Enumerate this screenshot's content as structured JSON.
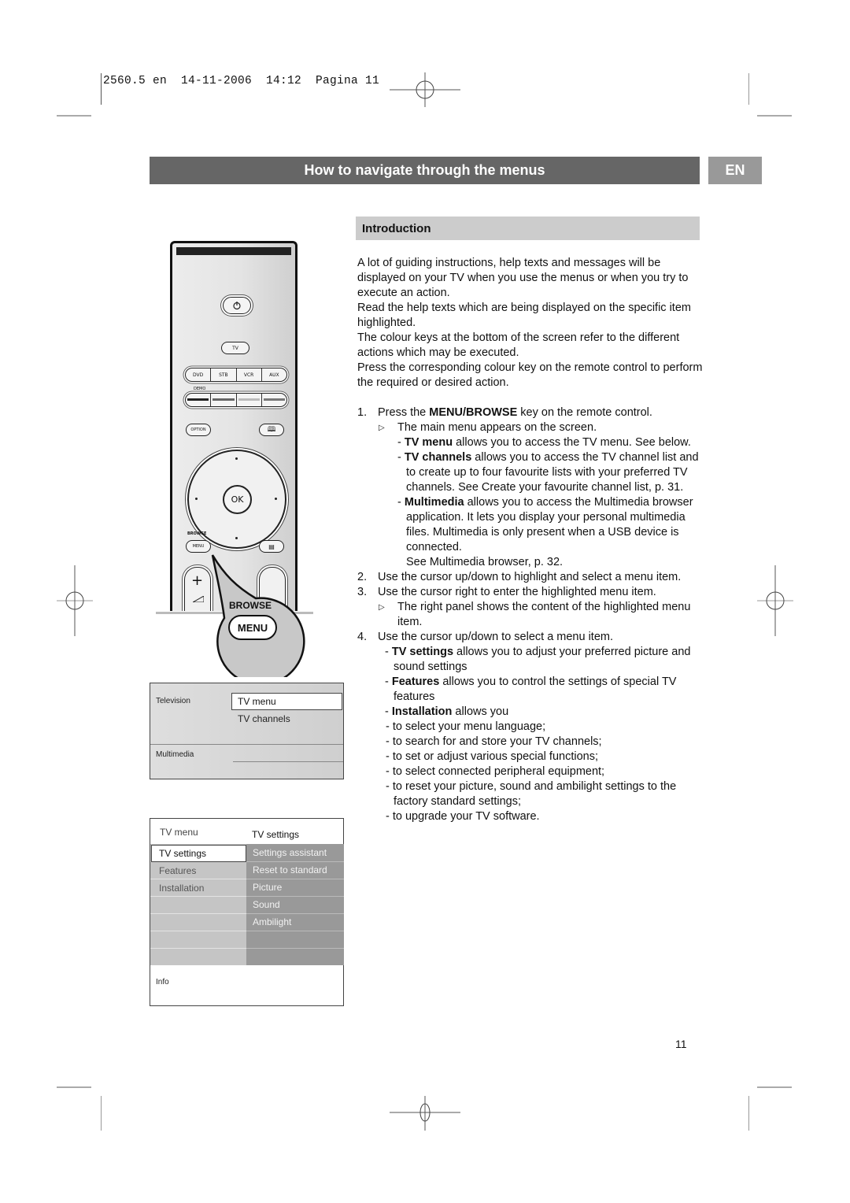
{
  "slug": {
    "text": "2560.5 en  14-11-2006  14:12  Pagina 11"
  },
  "header": {
    "title": "How to navigate through the menus",
    "language_tab": "EN"
  },
  "section": {
    "title": "Introduction"
  },
  "intro": [
    "A lot of guiding instructions, help texts and messages will be displayed on your TV when you use the menus or when you try to execute an action.",
    "Read the help texts which are being displayed on the specific item highlighted.",
    "The colour keys at the bottom of the screen refer to the different actions which may be executed.",
    "Press the corresponding colour key on the remote control to perform the required or desired action."
  ],
  "steps": {
    "s1": {
      "num": "1.",
      "pre": "Press the ",
      "bold": "MENU/BROWSE",
      "post": " key on the remote control."
    },
    "s1_result": "The main menu appears on the screen.",
    "s1_items": [
      {
        "bold": "TV menu",
        "text": " allows you to access the TV menu. See below."
      },
      {
        "bold": "TV channels",
        "text": " allows you to access the TV channel list and to create up to four favourite lists with your preferred TV channels. See Create your favourite channel list, p. 31."
      },
      {
        "bold": "Multimedia",
        "text": " allows you to access the Multimedia browser application. It lets you display your personal multimedia files. Multimedia is only present when a USB device is connected."
      }
    ],
    "s1_see": "See Multimedia browser, p. 32.",
    "s2": {
      "num": "2.",
      "text": "Use the cursor up/down to highlight and select a menu item."
    },
    "s3": {
      "num": "3.",
      "text": "Use the cursor right to enter the highlighted menu item."
    },
    "s3_result": "The right panel shows the content of the highlighted menu item.",
    "s4": {
      "num": "4.",
      "text": "Use the cursor up/down to select a menu item."
    },
    "s4_items": [
      {
        "bold": "TV settings",
        "text": " allows you to adjust your preferred picture and sound settings"
      },
      {
        "bold": "Features",
        "text": " allows you to control the settings of special TV features"
      },
      {
        "bold": "Installation",
        "text": " allows you"
      }
    ],
    "installation_items": [
      "to select your menu language;",
      "to search for and store your TV channels;",
      "to set or adjust various special functions;",
      "to select connected peripheral equipment;",
      "to reset your picture, sound and ambilight settings to the factory standard settings;",
      "to upgrade your TV software."
    ]
  },
  "remote": {
    "tv": "TV",
    "sources": [
      "DVD",
      "STB",
      "VCR",
      "AUX"
    ],
    "demo": "DEMO",
    "option": "OPTION",
    "ok": "OK",
    "browse_small": "BROWSE",
    "menu_small": "MENU",
    "vol_plus": "+",
    "callout_browse": "BROWSE",
    "callout_menu": "MENU",
    "color_keys": [
      "#222222",
      "#666666",
      "#bbbbbb",
      "#777777"
    ]
  },
  "screen_main_menu": {
    "television": "Television",
    "multimedia": "Multimedia",
    "selected": "TV menu",
    "item2": "TV channels"
  },
  "screen_tv_menu": {
    "left_header": "TV menu",
    "right_header": "TV settings",
    "left_items": [
      "TV settings",
      "Features",
      "Installation"
    ],
    "right_items": [
      "Settings assistant",
      "Reset to standard",
      "Picture",
      "Sound",
      "Ambilight"
    ],
    "info": "Info"
  },
  "footer": {
    "page_number": "11"
  }
}
